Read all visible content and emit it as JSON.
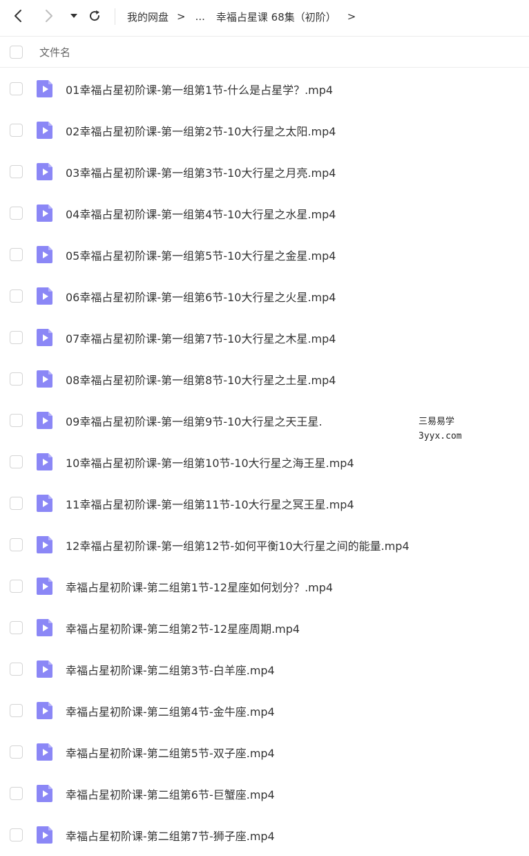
{
  "toolbar": {
    "breadcrumb": {
      "root": "我的网盘",
      "sep1": ">",
      "ellipsis": "...",
      "current": "幸福占星课 68集（初阶）",
      "sep2": ">"
    }
  },
  "header": {
    "column_name": "文件名"
  },
  "files": [
    "01幸福占星初阶课-第一组第1节-什么是占星学？.mp4",
    "02幸福占星初阶课-第一组第2节-10大行星之太阳.mp4",
    "03幸福占星初阶课-第一组第3节-10大行星之月亮.mp4",
    "04幸福占星初阶课-第一组第4节-10大行星之水星.mp4",
    "05幸福占星初阶课-第一组第5节-10大行星之金星.mp4",
    "06幸福占星初阶课-第一组第6节-10大行星之火星.mp4",
    "07幸福占星初阶课-第一组第7节-10大行星之木星.mp4",
    "08幸福占星初阶课-第一组第8节-10大行星之土星.mp4",
    "09幸福占星初阶课-第一组第9节-10大行星之天王星.",
    "10幸福占星初阶课-第一组第10节-10大行星之海王星.mp4",
    "11幸福占星初阶课-第一组第11节-10大行星之冥王星.mp4",
    "12幸福占星初阶课-第一组第12节-如何平衡10大行星之间的能量.mp4",
    "幸福占星初阶课-第二组第1节-12星座如何划分？.mp4",
    "幸福占星初阶课-第二组第2节-12星座周期.mp4",
    "幸福占星初阶课-第二组第3节-白羊座.mp4",
    "幸福占星初阶课-第二组第4节-金牛座.mp4",
    "幸福占星初阶课-第二组第5节-双子座.mp4",
    "幸福占星初阶课-第二组第6节-巨蟹座.mp4",
    "幸福占星初阶课-第二组第7节-狮子座.mp4"
  ],
  "watermark": {
    "line1": "三易易学",
    "line2": "3yyx.com"
  },
  "icons": {
    "back": "chevron-left-icon",
    "forward": "chevron-right-icon",
    "dropdown": "caret-down-icon",
    "refresh": "refresh-icon",
    "file": "video-file-icon"
  },
  "colors": {
    "file_icon": "#8b87f6",
    "text": "#333333",
    "muted": "#666666"
  }
}
